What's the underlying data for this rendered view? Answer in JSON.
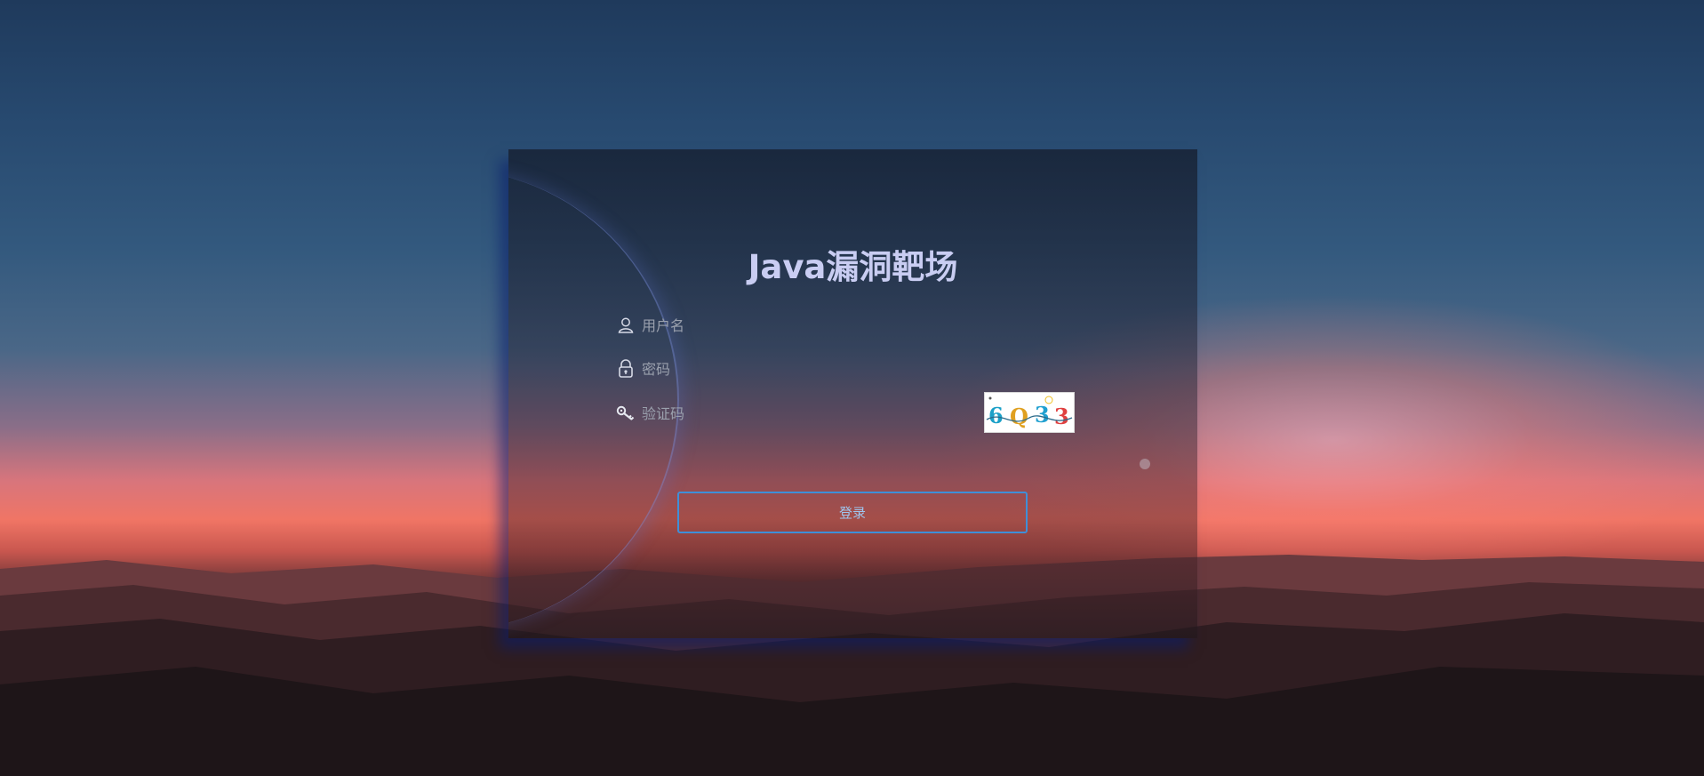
{
  "page": {
    "title": "Java漏洞靶场"
  },
  "form": {
    "username": {
      "placeholder": "用户名",
      "value": "",
      "icon": "user-icon"
    },
    "password": {
      "placeholder": "密码",
      "value": "",
      "icon": "lock-icon"
    },
    "captcha": {
      "placeholder": "验证码",
      "value": "",
      "icon": "key-icon",
      "image_text": "6Q33"
    },
    "login_label": "登录"
  },
  "colors": {
    "title": "#c9cdf2",
    "button_border": "#3f8fd8",
    "button_text": "#9ec6ef"
  }
}
